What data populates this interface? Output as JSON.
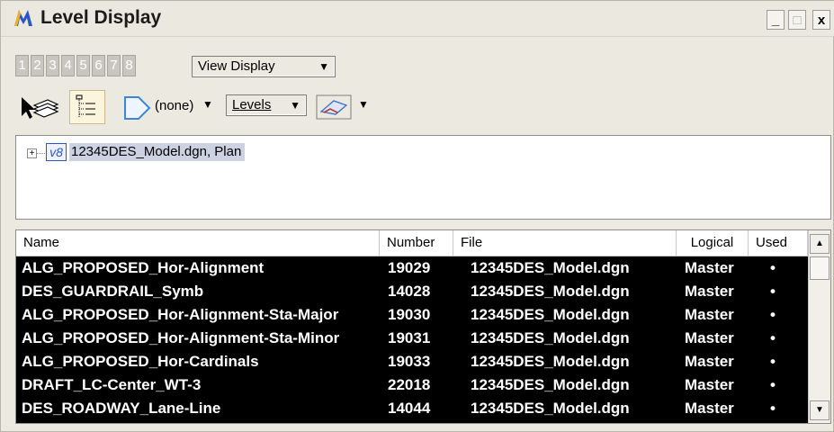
{
  "window": {
    "title": "Level Display",
    "minimize_label": "_",
    "maximize_label": "□",
    "close_label": "x"
  },
  "toolbar": {
    "view_numbers": [
      "1",
      "2",
      "3",
      "4",
      "5",
      "6",
      "7",
      "8"
    ],
    "view_display_value": "View Display",
    "symbology_value": "(none)",
    "levels_value": "Levels",
    "dropdown_arrow": "▼"
  },
  "tree": {
    "expander": "+",
    "badge": "v8",
    "item_label": "12345DES_Model.dgn, Plan"
  },
  "table": {
    "columns": [
      "Name",
      "Number",
      "File",
      "Logical",
      "Used"
    ],
    "rows": [
      {
        "name": "ALG_PROPOSED_Hor-Alignment",
        "number": "19029",
        "file": "12345DES_Model.dgn",
        "logical": "Master",
        "used": "•"
      },
      {
        "name": "DES_GUARDRAIL_Symb",
        "number": "14028",
        "file": "12345DES_Model.dgn",
        "logical": "Master",
        "used": "•"
      },
      {
        "name": "ALG_PROPOSED_Hor-Alignment-Sta-Major",
        "number": "19030",
        "file": "12345DES_Model.dgn",
        "logical": "Master",
        "used": "•"
      },
      {
        "name": "ALG_PROPOSED_Hor-Alignment-Sta-Minor",
        "number": "19031",
        "file": "12345DES_Model.dgn",
        "logical": "Master",
        "used": "•"
      },
      {
        "name": "ALG_PROPOSED_Hor-Cardinals",
        "number": "19033",
        "file": "12345DES_Model.dgn",
        "logical": "Master",
        "used": "•"
      },
      {
        "name": "DRAFT_LC-Center_WT-3",
        "number": "22018",
        "file": "12345DES_Model.dgn",
        "logical": "Master",
        "used": "•"
      },
      {
        "name": "DES_ROADWAY_Lane-Line",
        "number": "14044",
        "file": "12345DES_Model.dgn",
        "logical": "Master",
        "used": "•"
      }
    ],
    "scroll_up": "▲",
    "scroll_down": "▼"
  },
  "icons": {
    "title": "microstation-icon",
    "level-manager": "level-manager-icon",
    "tree-toggle": "tree-view-icon",
    "filter": "filter-icon",
    "symbology": "symbology-icon"
  },
  "colors": {
    "selection_row_bg": "#000000",
    "selection_row_fg": "#ffffff",
    "tree_selection_bg": "#ccd2e2",
    "accent_blue": "#2b56c8"
  }
}
